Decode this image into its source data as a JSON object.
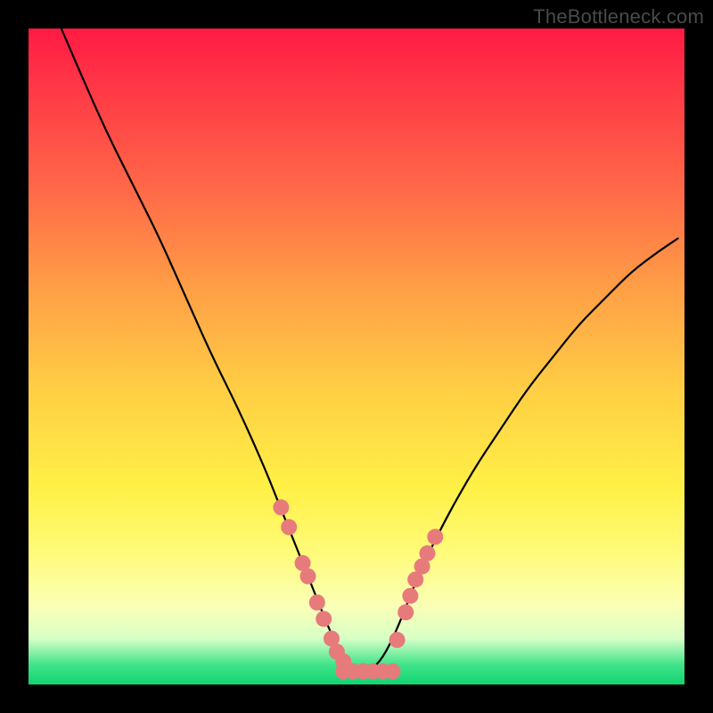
{
  "attribution": "TheBottleneck.com",
  "chart_data": {
    "type": "line",
    "title": "",
    "xlabel": "",
    "ylabel": "",
    "xlim": [
      0,
      100
    ],
    "ylim": [
      0,
      100
    ],
    "series": [
      {
        "name": "bottleneck-curve",
        "x": [
          5,
          8,
          12,
          16,
          20,
          24,
          28,
          32,
          36,
          38,
          40,
          42,
          44,
          46,
          48,
          50,
          52,
          54,
          56,
          58,
          60,
          64,
          68,
          72,
          76,
          80,
          84,
          88,
          92,
          96,
          99
        ],
        "y": [
          100,
          93,
          84,
          76,
          68,
          59,
          50,
          42,
          33,
          28,
          23,
          18,
          13,
          8,
          4,
          2,
          2,
          4,
          8,
          13,
          18,
          26,
          33,
          39,
          45,
          50,
          55,
          59,
          63,
          66,
          68
        ]
      }
    ],
    "markers_left": {
      "name": "cpu-options-left",
      "x": [
        38.5,
        39.7,
        41.8,
        42.6,
        44.0,
        45.0,
        46.2,
        47.0,
        48.0
      ],
      "y": [
        27.0,
        24.0,
        18.5,
        16.5,
        12.5,
        10.0,
        7.0,
        5.0,
        3.5
      ]
    },
    "markers_right": {
      "name": "cpu-options-right",
      "x": [
        56.2,
        57.5,
        58.2,
        59.0,
        60.0,
        60.8,
        62.0
      ],
      "y": [
        6.8,
        11.0,
        13.5,
        16.0,
        18.0,
        20.0,
        22.5
      ]
    },
    "markers_bottom": {
      "name": "optimal-range",
      "x": [
        48.0,
        49.5,
        51.0,
        52.5,
        54.0,
        55.5
      ],
      "y": [
        2.0,
        2.0,
        2.0,
        2.0,
        2.0,
        2.0
      ]
    },
    "marker_color": "#e77a7b",
    "marker_radius": 9
  }
}
